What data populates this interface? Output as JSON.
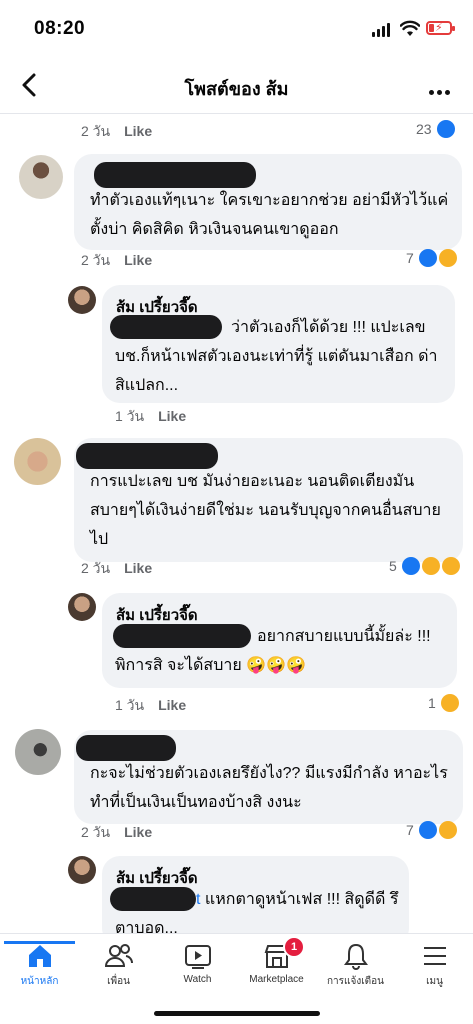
{
  "status_bar": {
    "time": "08:20"
  },
  "header": {
    "title": "โพสต์ของ ส้ม"
  },
  "post_footer": {
    "time": "2 วัน",
    "like": "Like",
    "reaction_count": "23"
  },
  "comments": [
    {
      "lines": [
        "ทำตัวเองแท้ๆเนาะ ใครเขาะอยากช่วย อย่ามีหัวไว้แค่",
        "ตั้งบ่า คิดสิคิด หิวเงินจนคนเขาดูออก"
      ],
      "time": "2 วัน",
      "like": "Like",
      "reaction_count": "7",
      "reply": {
        "name": "ส้ม เปรี้ยวจี๊ด",
        "lines": [
          "ว่าตัวเองก็ได้ด้วย !!! แปะเลข",
          "บช.ก็หน้าเฟสตัวเองนะเท่าที่รู้ แต่ดันมาเสือก ด่า",
          "สิแปลก..."
        ],
        "time": "1 วัน",
        "like": "Like"
      }
    },
    {
      "lines": [
        "การแปะเลข บช มันง่ายอะเนอะ นอนติดเตียงมัน",
        "สบายๆได้เงินง่ายดีใช่มะ นอนรับบุญจากคนอื่นสบาย",
        "ไป"
      ],
      "time": "2 วัน",
      "like": "Like",
      "reaction_count": "5",
      "reply": {
        "name": "ส้ม เปรี้ยวจี๊ด",
        "lines": [
          "อยากสบายแบบนี้มั้ยล่ะ !!!",
          "พิการสิ จะได้สบาย 🤪🤪🤪"
        ],
        "time": "1 วัน",
        "like": "Like",
        "reaction_count": "1"
      }
    },
    {
      "lines": [
        "กะจะไม่ช่วยตัวเองเลยรึยังไง?? มีแรงมีกำลัง หาอะไร",
        "ทำที่เป็นเงินเป็นทองบ้างสิ งงนะ"
      ],
      "time": "2 วัน",
      "like": "Like",
      "reaction_count": "7",
      "reply": {
        "name": "ส้ม เปรี้ยวจี๊ด",
        "link_fragment": "t",
        "lines": [
          "แหกตาดูหน้าเฟส !!! สิดูดีดี รึ",
          "ตาบอด..."
        ]
      }
    }
  ],
  "tabbar": {
    "items": [
      {
        "label": "หน้าหลัก",
        "icon": "home-icon",
        "active": true
      },
      {
        "label": "เพื่อน",
        "icon": "friends-icon"
      },
      {
        "label": "Watch",
        "icon": "watch-icon"
      },
      {
        "label": "Marketplace",
        "icon": "marketplace-icon",
        "badge": "1"
      },
      {
        "label": "การแจ้งเตือน",
        "icon": "bell-icon"
      },
      {
        "label": "เมนู",
        "icon": "menu-icon"
      }
    ]
  },
  "colors": {
    "accent": "#1877f2",
    "bubble": "#f0f2f5",
    "meta": "#65676b",
    "badge": "#e41e3f"
  }
}
